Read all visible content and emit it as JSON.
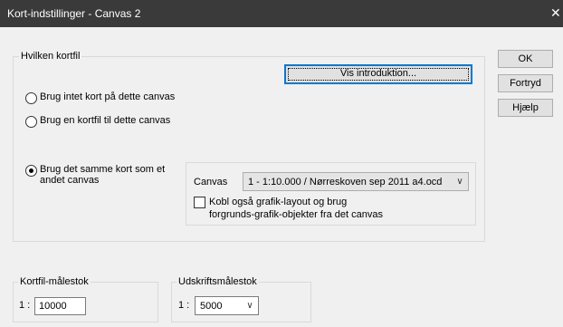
{
  "window": {
    "title": "Kort-indstillinger - Canvas 2",
    "close_glyph": "✕"
  },
  "group_map_file": {
    "legend": "Hvilken kortfil",
    "intro_button": "Vis introduktion...",
    "radio_none": "Brug intet kort på dette canvas",
    "radio_file": "Brug en kortfil til dette canvas",
    "radio_same_line1": "Brug det samme kort som et",
    "radio_same_line2": "andet canvas",
    "selected_radio": "radio_same"
  },
  "canvas_panel": {
    "label": "Canvas",
    "selected": "1 - 1:10.000 / Nørreskoven sep 2011 a4.ocd",
    "link_checkbox_line1": "Kobl også grafik-layout og brug",
    "link_checkbox_line2": "forgrunds-grafik-objekter fra det canvas",
    "link_checked": false
  },
  "map_scale": {
    "legend": "Kortfil-målestok",
    "prefix": "1 :",
    "value": "10000"
  },
  "print_scale": {
    "legend": "Udskriftsmålestok",
    "prefix": "1 :",
    "value": "5000"
  },
  "buttons": {
    "ok": "OK",
    "cancel": "Fortryd",
    "help": "Hjælp"
  }
}
